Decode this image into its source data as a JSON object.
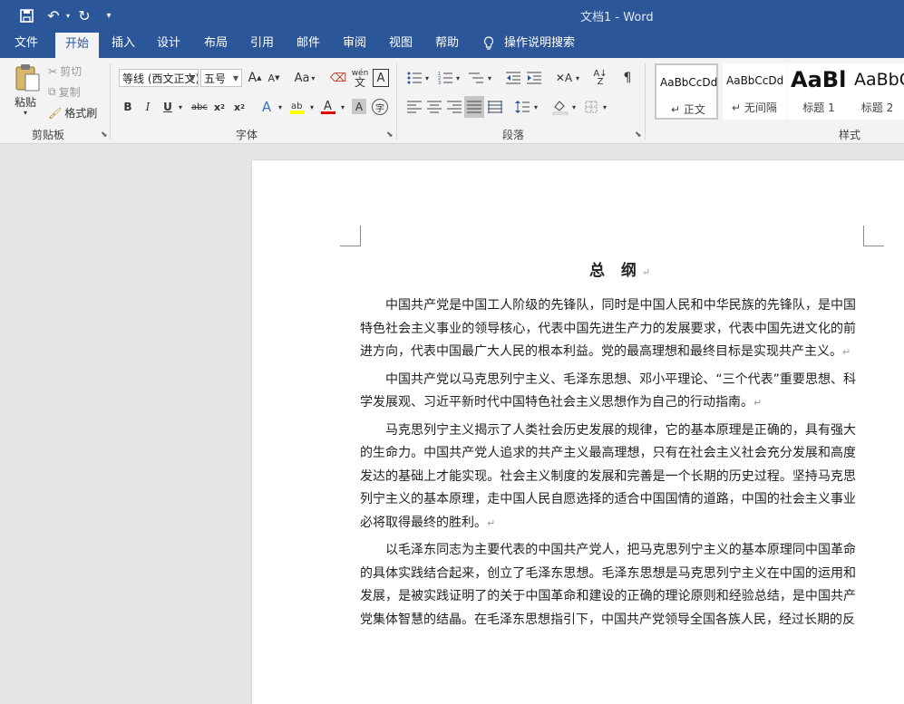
{
  "title_bar": {
    "doc_title": "文档1 - Word"
  },
  "tabs": [
    "文件",
    "开始",
    "插入",
    "设计",
    "布局",
    "引用",
    "邮件",
    "审阅",
    "视图",
    "帮助"
  ],
  "tell_me": "操作说明搜索",
  "clipboard": {
    "paste": "粘贴",
    "cut": "剪切",
    "copy": "复制",
    "format_painter": "格式刷",
    "group_label": "剪贴板"
  },
  "font": {
    "font_name": "等线 (西文正文)",
    "font_size": "五号",
    "change_case": "Aa",
    "pinyin": "wén",
    "group_label": "字体"
  },
  "paragraph": {
    "group_label": "段落"
  },
  "styles": {
    "group_label": "样式",
    "items": [
      {
        "sample": "AaBbCcDd",
        "name": "正文"
      },
      {
        "sample": "AaBbCcDd",
        "name": "无间隔"
      },
      {
        "sample": "AaBl",
        "name": "标题 1"
      },
      {
        "sample": "AaBbC",
        "name": "标题 2"
      }
    ]
  },
  "document": {
    "heading": "总 纲",
    "paragraphs": [
      "中国共产党是中国工人阶级的先锋队，同时是中国人民和中华民族的先锋队，是中国特色社会主义事业的领导核心，代表中国先进生产力的发展要求，代表中国先进文化的前进方向，代表中国最广大人民的根本利益。党的最高理想和最终目标是实现共产主义。",
      "中国共产党以马克思列宁主义、毛泽东思想、邓小平理论、“三个代表”重要思想、科学发展观、习近平新时代中国特色社会主义思想作为自己的行动指南。",
      "马克思列宁主义揭示了人类社会历史发展的规律，它的基本原理是正确的，具有强大的生命力。中国共产党人追求的共产主义最高理想，只有在社会主义社会充分发展和高度发达的基础上才能实现。社会主义制度的发展和完善是一个长期的历史过程。坚持马克思列宁主义的基本原理，走中国人民自愿选择的适合中国国情的道路，中国的社会主义事业必将取得最终的胜利。",
      "以毛泽东同志为主要代表的中国共产党人，把马克思列宁主义的基本原理同中国革命的具体实践结合起来，创立了毛泽东思想。毛泽东思想是马克思列宁主义在中国的运用和发展，是被实践证明了的关于中国革命和建设的正确的理论原则和经验总结，是中国共产党集体智慧的结晶。在毛泽东思想指引下，中国共产党领导全国各族人民，经过长期的反"
    ]
  }
}
